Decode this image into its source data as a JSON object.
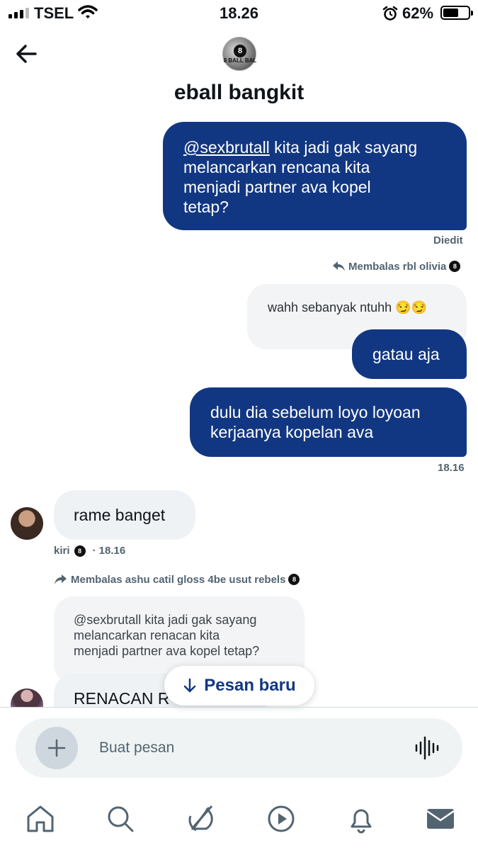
{
  "status_bar": {
    "carrier": "TSEL",
    "time": "18.26",
    "battery_percent": "62%",
    "battery_level": 0.62,
    "icons": [
      "signal-icon",
      "wifi-icon",
      "alarm-icon",
      "battery-icon"
    ]
  },
  "header": {
    "title": "eball bangkit",
    "avatar_text": "8 BALL BAL"
  },
  "messages": {
    "m1": {
      "mention": "@sexbrutall",
      "line1_rest": " kita jadi gak sayang",
      "line2": "melancarkan rencana kita",
      "line3": "menjadi partner ava kopel",
      "line4": "tetap?"
    },
    "m1_meta": "Diedit",
    "reply1_label": "Membalas rbl olivia",
    "quote1": "wahh sebanyak ntuhh 😏😏",
    "m2": "gatau aja",
    "m3_line1": "dulu dia sebelum loyo loyoan",
    "m3_line2": "kerjaanya kopelan ava",
    "m3_meta": "18.16",
    "recv1": "rame banget",
    "recv1_sender": "kiri",
    "recv1_time": "· 18.16",
    "reply2_label": "Membalas ashu catil gloss 4be usut rebels",
    "quote2_line1": "@sexbrutall kita jadi gak sayang",
    "quote2_line2": "melancarkan renacan kita",
    "quote2_line3": "menjadi partner ava kopel tetap?",
    "recv2_partial": "RENACAN R"
  },
  "new_messages_pill": "Pesan baru",
  "composer": {
    "placeholder": "Buat pesan"
  },
  "tabbar": {
    "items": [
      "home-icon",
      "search-icon",
      "grok-icon",
      "video-icon",
      "notifications-icon",
      "messages-icon"
    ]
  },
  "colors": {
    "sent_bubble": "#123782",
    "received_bubble": "#eff2f5",
    "accent": "#123782"
  }
}
